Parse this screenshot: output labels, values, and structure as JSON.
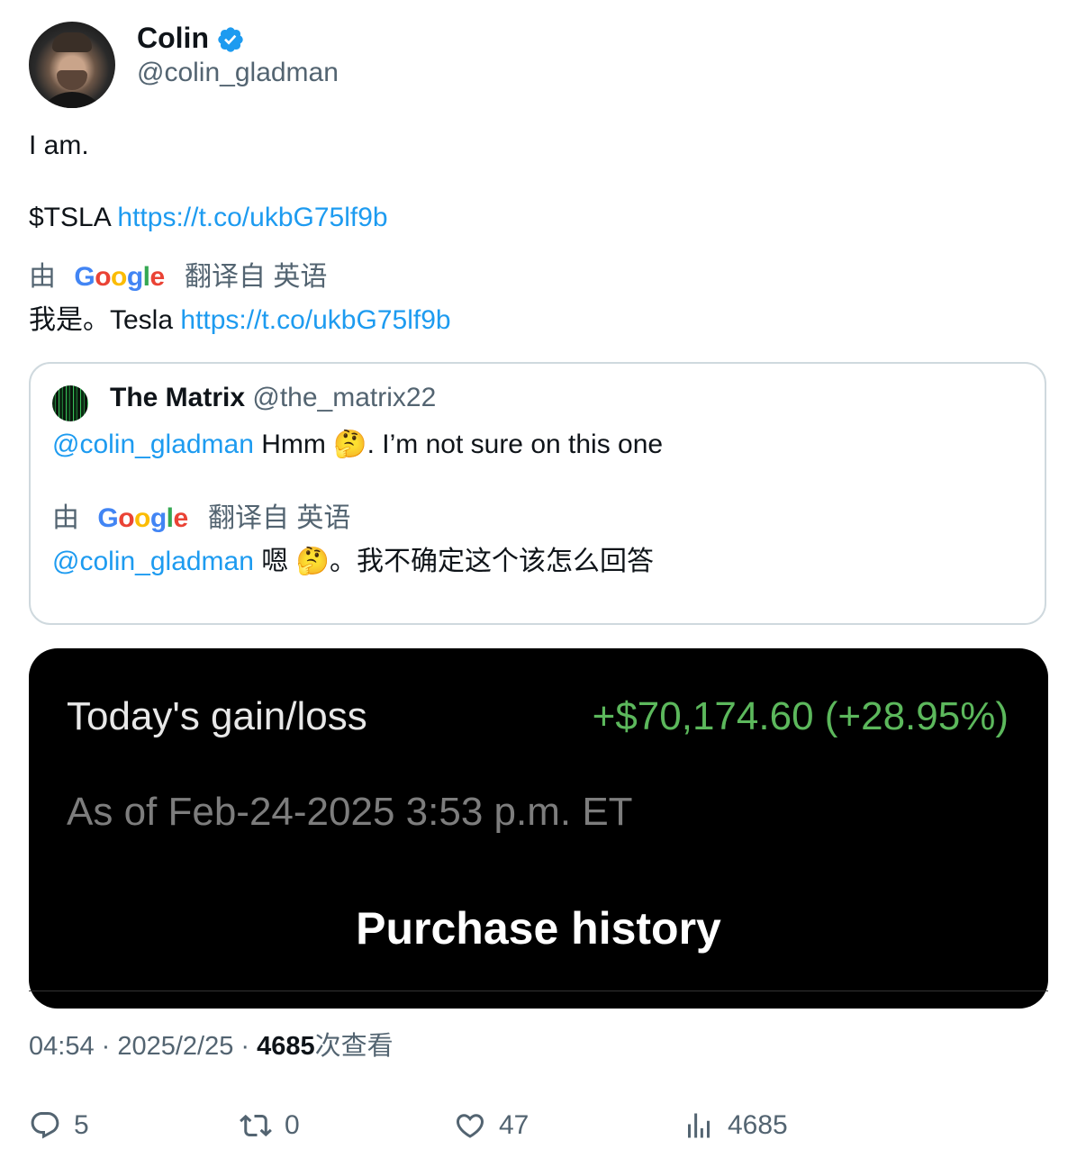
{
  "author": {
    "name": "Colin",
    "handle": "@colin_gladman"
  },
  "tweet": {
    "line1": "I am.",
    "cashtag": "$TSLA",
    "link": "https://t.co/ukbG75lf9b",
    "translation": {
      "by": "由",
      "google": {
        "g": "G",
        "o1": "o",
        "o2": "o",
        "g2": "g",
        "l": "l",
        "e": "e"
      },
      "from": "翻译自 英语",
      "text": "我是。Tesla",
      "link": "https://t.co/ukbG75lf9b"
    }
  },
  "quote": {
    "name": "The Matrix",
    "handle": "@the_matrix22",
    "mention": "@colin_gladman",
    "text": "Hmm 🤔. I’m not sure on this one",
    "translation": {
      "by": "由",
      "from": "翻译自 英语",
      "mention": "@colin_gladman",
      "text": "嗯 🤔。我不确定这个该怎么回答"
    }
  },
  "media": {
    "label": "Today's gain/loss",
    "value": "+$70,174.60 (+28.95%)",
    "as_of": "As of Feb-24-2025 3:53 p.m. ET",
    "purchase": "Purchase history"
  },
  "meta": {
    "time": "04:54",
    "sep1": " · ",
    "date": "2025/2/25",
    "sep2": " · ",
    "views": "4685",
    "views_suffix": "次查看"
  },
  "actions": {
    "replies": "5",
    "reposts": "0",
    "likes": "47",
    "views": "4685"
  },
  "colors": {
    "link": "#1d9bf0",
    "verified": "#1d9bf0",
    "gain": "#5cb85c"
  }
}
